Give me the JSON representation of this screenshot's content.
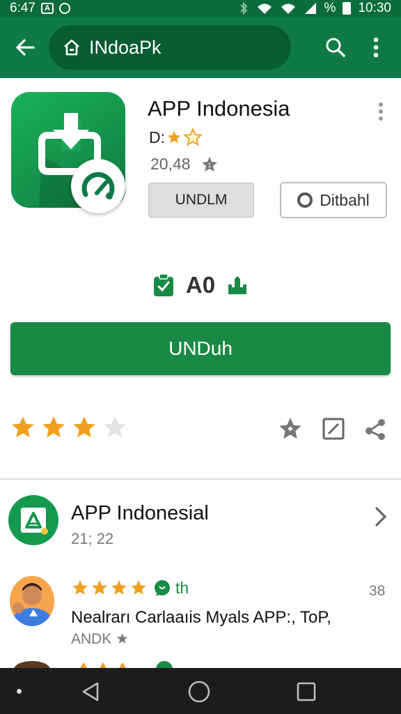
{
  "status_bar": {
    "time_left": "6:47",
    "icon_box_letter": "A",
    "time_right": "10:30",
    "battery_text": "%"
  },
  "app_bar": {
    "search_text": "INdoaPk",
    "icons": [
      "back-arrow-icon",
      "home-icon",
      "search-icon",
      "more-vert-icon"
    ]
  },
  "app": {
    "title": "APP Indonesia",
    "rating_prefix": "D:",
    "count": "20,48",
    "grey_button": "UNDLM",
    "outline_button": "Ditbahl"
  },
  "center_stat": {
    "value": "A0"
  },
  "primary_button": "UNDuh",
  "rating_stars": {
    "filled": 3,
    "total": 4
  },
  "related": {
    "title": "APP Indonesial",
    "subtitle": "21; 22"
  },
  "review": {
    "stars": 4,
    "tag": "th",
    "count": "38",
    "text": "Nealrarı Carlaaıis Myals APP:, ToP,",
    "author": "ANDK ★"
  },
  "colors": {
    "status_bar": "#0b6b3a",
    "app_bar": "#0f7a45",
    "primary": "#188a45",
    "star": "#f0a020"
  }
}
